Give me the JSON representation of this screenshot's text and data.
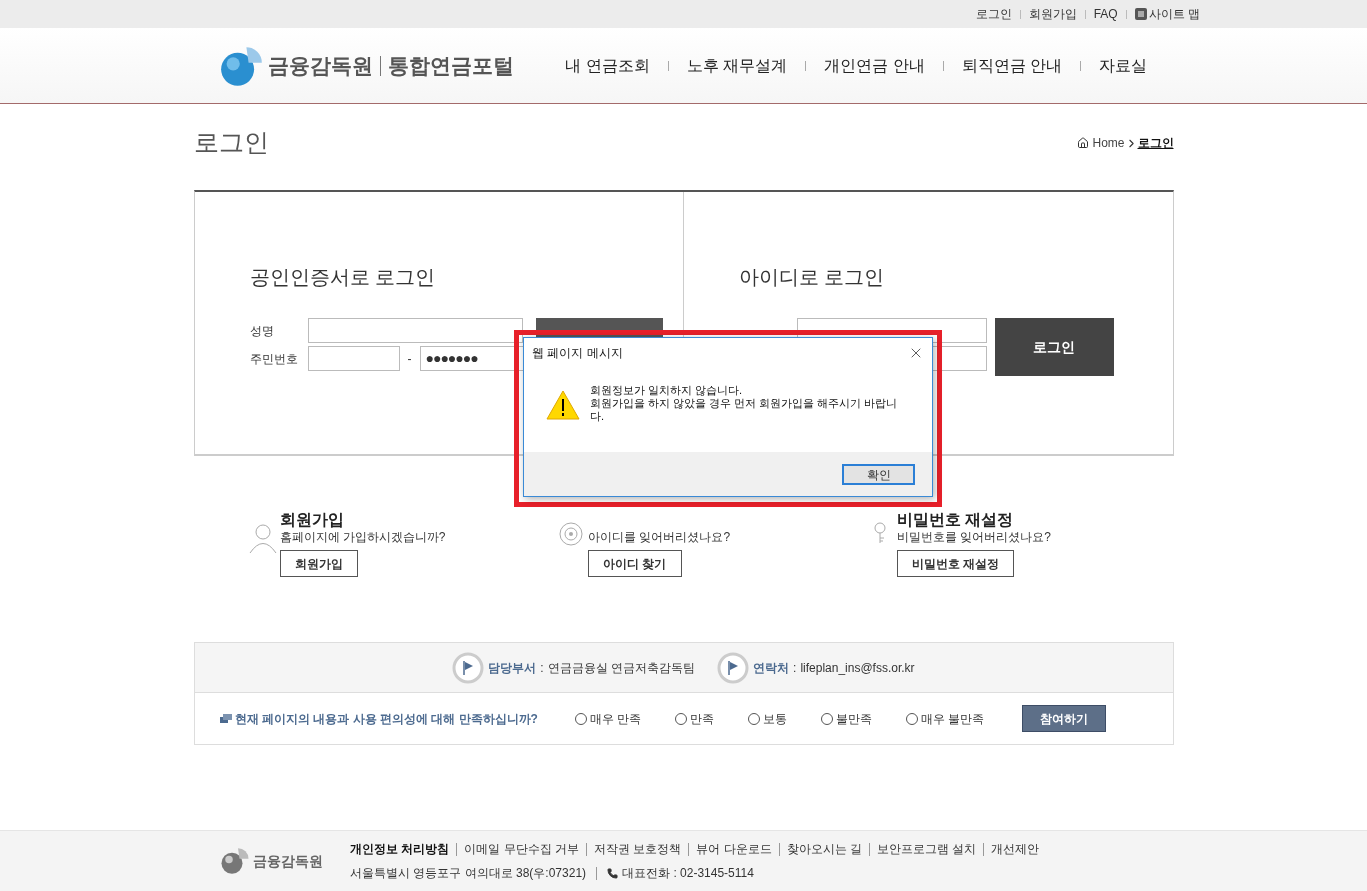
{
  "top_links": [
    {
      "label": "로그인"
    },
    {
      "label": "회원가입"
    },
    {
      "label": "FAQ"
    },
    {
      "label": "사이트 맵",
      "icon": true
    }
  ],
  "logo": {
    "org": "금융감독원",
    "portal": "통합연금포털"
  },
  "nav": [
    {
      "label": "내 연금조회"
    },
    {
      "label": "노후 재무설계"
    },
    {
      "label": "개인연금 안내"
    },
    {
      "label": "퇴직연금 안내"
    },
    {
      "label": "자료실"
    }
  ],
  "page_title": "로그인",
  "breadcrumb": [
    {
      "label": "Home",
      "current": false
    },
    {
      "label": "로그인",
      "current": true
    }
  ],
  "cert_login": {
    "title": "공인인증서로 로그인",
    "name_label": "성명",
    "rrn_label": "주민번호",
    "rrn_dash": "-",
    "rrn_masked": "●●●●●●●"
  },
  "id_login": {
    "title": "아이디로 로그인",
    "button": "로그인"
  },
  "cards": [
    {
      "kind": "person",
      "title": "회원가입",
      "text": "홈페이지에 가입하시겠습니까?",
      "button": "회원가입"
    },
    {
      "kind": "wheel",
      "text": "아이디를 잊어버리셨나요?",
      "button": "아이디 찾기"
    },
    {
      "kind": "key",
      "title": "비밀번호 재설정",
      "text": "비밀번호를 잊어버리셨나요?",
      "button": "비밀번호 재설정"
    }
  ],
  "contact": [
    {
      "label": "담당부서",
      "separator": ":",
      "value": "연금금융실 연금저축감독팀"
    },
    {
      "label": "연락처",
      "separator": ":",
      "value": "lifeplan_ins@fss.or.kr"
    }
  ],
  "survey": {
    "question": "현재 페이지의 내용과 사용 편의성에 대해 만족하십니까?",
    "options": [
      {
        "label": "매우 만족",
        "selected": false
      },
      {
        "label": "만족",
        "selected": false
      },
      {
        "label": "보통",
        "selected": false
      },
      {
        "label": "불만족",
        "selected": false
      },
      {
        "label": "매우 불만족",
        "selected": false
      }
    ],
    "button": "참여하기"
  },
  "footer": {
    "org": "금융감독원",
    "links": [
      {
        "label": "개인정보 처리방침",
        "bold": true
      },
      {
        "label": "이메일 무단수집 거부",
        "bold": false
      },
      {
        "label": "저작권 보호정책",
        "bold": false
      },
      {
        "label": "뷰어 다운로드",
        "bold": false
      },
      {
        "label": "찾아오시는 길",
        "bold": false
      },
      {
        "label": "보안프로그램 설치",
        "bold": false
      },
      {
        "label": "개선제안",
        "bold": false
      }
    ],
    "address": "서울특별시 영등포구 여의대로 38(우:07321)",
    "phone": "대표전화 : 02-3145-5114"
  },
  "dialog": {
    "title": "웹 페이지 메시지",
    "lines": [
      "회원정보가 일치하지 않습니다.",
      "회원가입을 하지 않았을 경우 먼저 회원가입을 해주시기 바랍니",
      "다."
    ],
    "button": "확인",
    "highlighted": true
  }
}
